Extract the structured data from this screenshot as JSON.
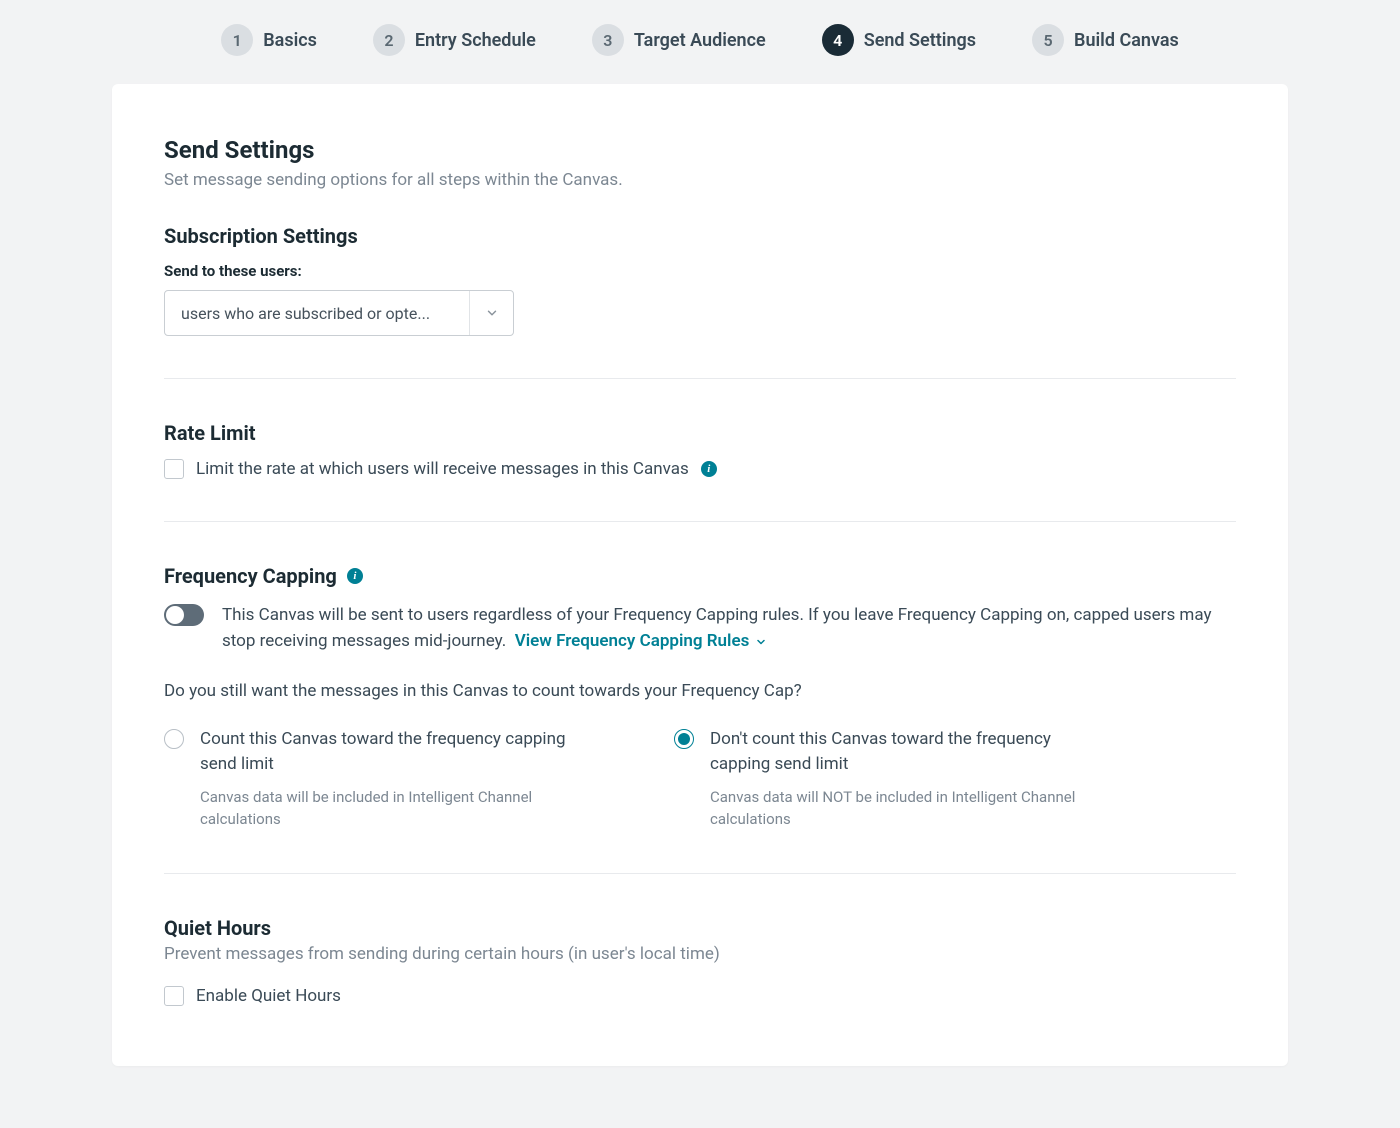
{
  "colors": {
    "accent": "#008095",
    "text": "#1c2b33",
    "muted": "#7c8792"
  },
  "stepper": {
    "active_index": 3,
    "steps": [
      {
        "n": "1",
        "label": "Basics"
      },
      {
        "n": "2",
        "label": "Entry Schedule"
      },
      {
        "n": "3",
        "label": "Target Audience"
      },
      {
        "n": "4",
        "label": "Send Settings"
      },
      {
        "n": "5",
        "label": "Build Canvas"
      }
    ]
  },
  "page": {
    "title": "Send Settings",
    "subtitle": "Set message sending options for all steps within the Canvas."
  },
  "subscription": {
    "heading": "Subscription Settings",
    "label": "Send to these users:",
    "value": "users who are subscribed or opte..."
  },
  "rate_limit": {
    "heading": "Rate Limit",
    "checkbox_label": "Limit the rate at which users will receive messages in this Canvas",
    "checked": false
  },
  "frequency": {
    "heading": "Frequency Capping",
    "toggle_on": false,
    "description": "This Canvas will be sent to users regardless of your Frequency Capping rules. If you leave Frequency Capping on, capped users may stop receiving messages mid-journey.",
    "link": "View Frequency Capping Rules",
    "question": "Do you still want the messages in this Canvas to count towards your Frequency Cap?",
    "selected": 1,
    "options": [
      {
        "label": "Count this Canvas toward the frequency capping send limit",
        "help": "Canvas data will be included in Intelligent Channel calculations"
      },
      {
        "label": "Don't count this Canvas toward the frequency capping send limit",
        "help": "Canvas data will NOT be included in Intelligent Channel calculations"
      }
    ]
  },
  "quiet_hours": {
    "heading": "Quiet Hours",
    "subtitle": "Prevent messages from sending during certain hours (in user's local time)",
    "checkbox_label": "Enable Quiet Hours",
    "checked": false
  }
}
